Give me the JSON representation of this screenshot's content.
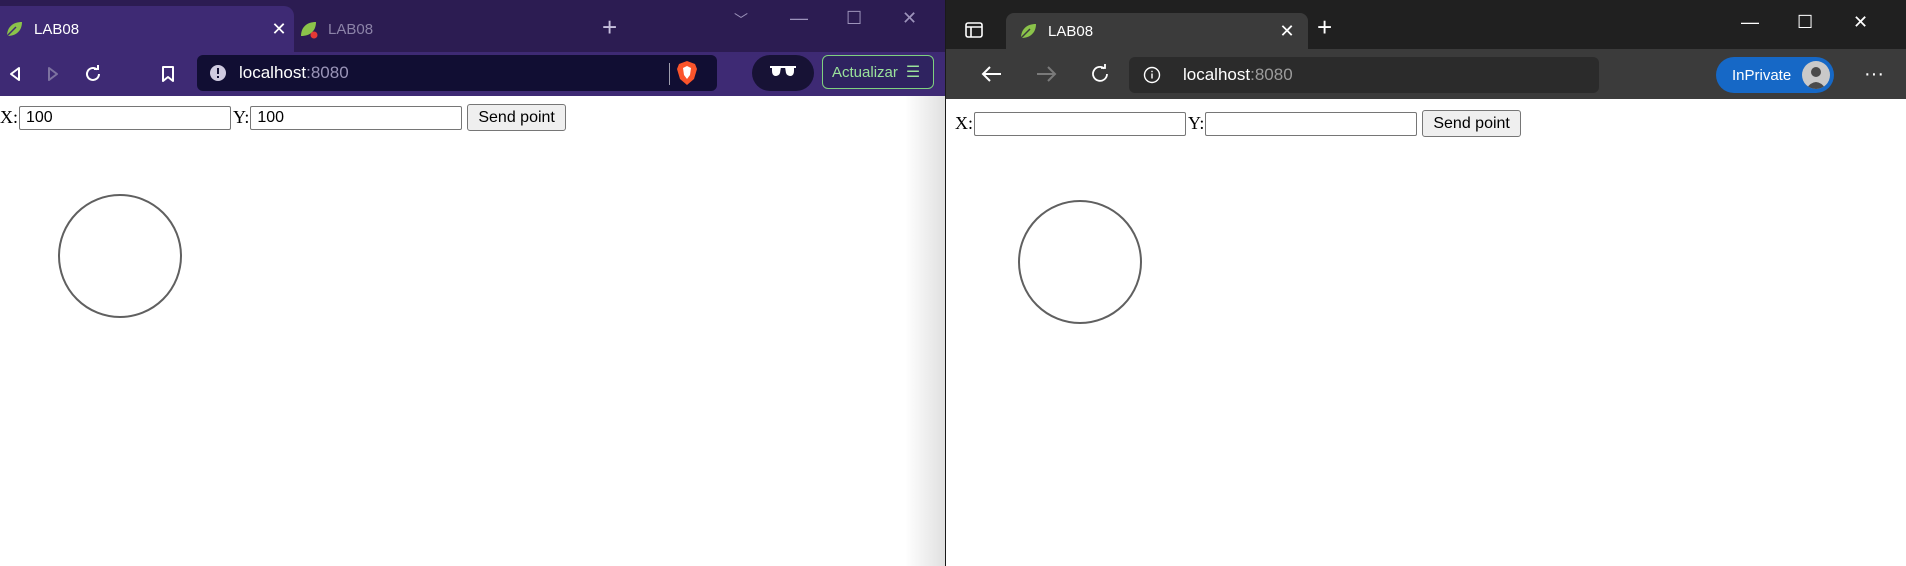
{
  "brave": {
    "tabs": [
      {
        "title": "LAB08",
        "active": true
      },
      {
        "title": "LAB08",
        "active": false
      }
    ],
    "url": {
      "host": "localhost",
      "port": ":8080"
    },
    "update_button": "Actualizar",
    "form": {
      "x_label": "X:",
      "x_value": "100",
      "y_label": "Y:",
      "y_value": "100",
      "send_label": "Send point"
    }
  },
  "edge": {
    "tabs": [
      {
        "title": "LAB08",
        "active": true
      }
    ],
    "url": {
      "host": "localhost",
      "port": ":8080"
    },
    "inprivate_label": "InPrivate",
    "form": {
      "x_label": "X:",
      "x_value": "",
      "y_label": "Y:",
      "y_value": "",
      "send_label": "Send point"
    }
  },
  "colors": {
    "brave_tabbar": "#2c1c52",
    "brave_toolbar": "#3e2a74",
    "edge_tabbar": "#202020",
    "edge_toolbar": "#3b3b3b",
    "inprivate": "#1668c6",
    "circle_stroke": "#606060"
  },
  "icons": [
    "spring-leaf-icon",
    "close-icon",
    "plus-icon",
    "chevron-down-icon",
    "minimize-icon",
    "maximize-icon",
    "back-icon",
    "forward-icon",
    "reload-icon",
    "bookmark-icon",
    "info-icon",
    "brave-shield-icon",
    "glasses-icon",
    "menu-icon",
    "read-aloud-icon",
    "add-favorite-icon",
    "favorites-icon",
    "collections-icon",
    "more-icon",
    "tab-actions-icon"
  ]
}
